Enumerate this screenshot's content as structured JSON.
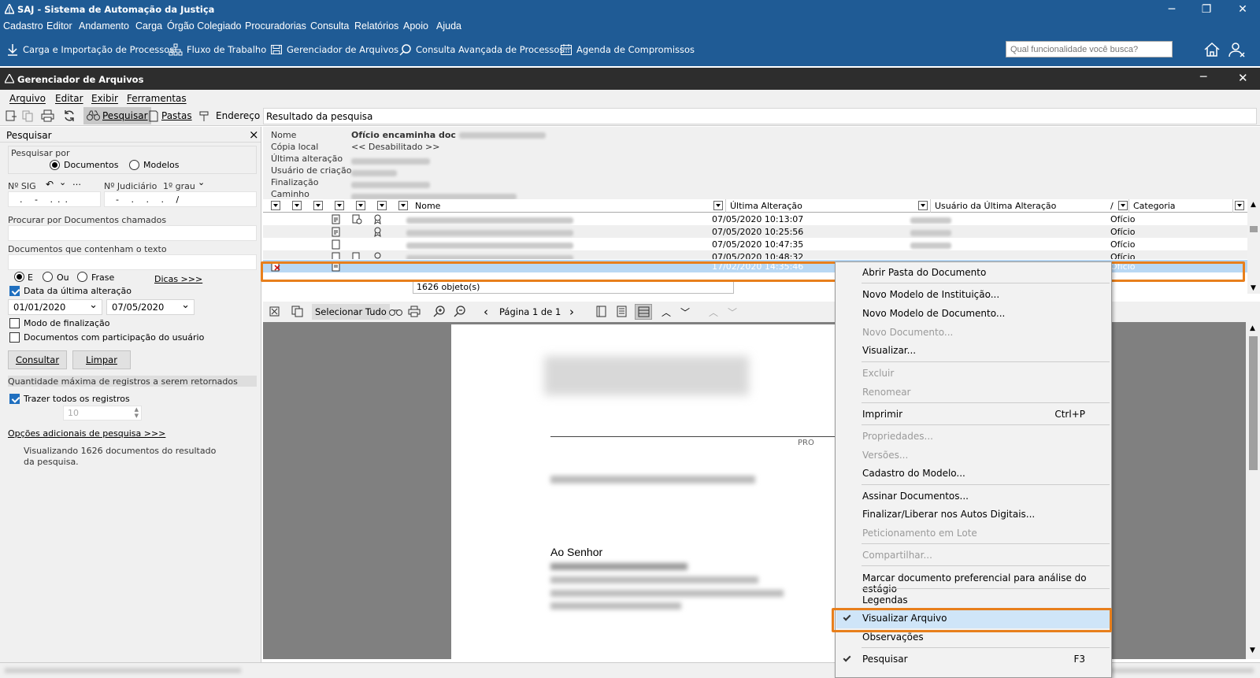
{
  "app": {
    "title": "SAJ - Sistema de Automação da Justiça",
    "menu": [
      "Cadastro",
      "Editor",
      "Andamento",
      "Carga",
      "Órgão Colegiado",
      "Procuradorias",
      "Consulta",
      "Relatórios",
      "Apoio",
      "Ajuda"
    ],
    "quick_actions": [
      "Carga e Importação de Processos",
      "Fluxo de Trabalho",
      "Gerenciador de Arquivos",
      "Consulta Avançada de Processos",
      "Agenda de Compromissos"
    ],
    "search_placeholder": "Qual funcionalidade você busca?"
  },
  "file_manager": {
    "title": "Gerenciador de Arquivos",
    "menu": [
      "Arquivo",
      "Editar",
      "Exibir",
      "Ferramentas"
    ],
    "toolbar": {
      "pesquisar": "Pesquisar",
      "pastas": "Pastas",
      "endereco": "Endereço"
    },
    "address_value": "Resultado da pesquisa"
  },
  "search_panel": {
    "title": "Pesquisar",
    "close": "×",
    "search_by_label": "Pesquisar por",
    "opt_documentos": "Documentos",
    "opt_modelos": "Modelos",
    "sig_label": "Nº SIG",
    "sig_value": ". - ...",
    "judicial_label": "Nº Judiciário",
    "grau": "1º grau",
    "judicial_value": "- . . . /",
    "docs_called_label": "Procurar por Documentos chamados",
    "docs_text_label": "Documentos que contenham o texto",
    "opt_e": "E",
    "opt_ou": "Ou",
    "opt_frase": "Frase",
    "dicas": "Dicas >>>",
    "last_change_label": "Data da última alteração",
    "date_from": "01/01/2020",
    "date_to": "07/05/2020",
    "finalization_label": "Modo de finalização",
    "participation_label": "Documentos com participação do usuário",
    "consultar": "Consultar",
    "limpar": "Limpar",
    "max_records_label": "Quantidade máxima de registros a serem retornados",
    "all_records_label": "Trazer todos os registros",
    "max_value": "10",
    "more_options": "Opções adicionais de pesquisa >>>",
    "result_info": "Visualizando 1626 documentos do resultado da pesquisa."
  },
  "properties": {
    "labels": [
      "Nome",
      "Cópia local",
      "Última alteração",
      "Usuário de criação",
      "Finalização",
      "Caminho"
    ],
    "nome_value": "Ofício encaminha doc",
    "copia_value": "<< Desabilitado >>"
  },
  "grid": {
    "headers": {
      "nome": "Nome",
      "ultima": "Última Alteração",
      "usuario": "Usuário da Última Alteração",
      "sort": "/",
      "categoria": "Categoria"
    },
    "rows": [
      {
        "date": "07/05/2020 10:13:07",
        "cat": "Ofício"
      },
      {
        "date": "07/05/2020 10:25:56",
        "cat": "Ofício"
      },
      {
        "date": "07/05/2020 10:47:35",
        "cat": "Ofício"
      },
      {
        "date": "07/05/2020 10:48:32",
        "cat": "Ofício"
      },
      {
        "date": "17/02/2020 14:35:46",
        "cat": "Ofício"
      }
    ],
    "status": "1626 objeto(s)"
  },
  "viewer": {
    "select_all": "Selecionar Tudo",
    "page": "Página 1 de 1",
    "doc_greeting": "Ao Senhor",
    "doc_pro": "PRO"
  },
  "context_menu": {
    "items": [
      {
        "label": "Abrir Pasta do Documento",
        "disabled": false
      },
      {
        "label": "Novo Modelo de Instituição...",
        "disabled": false
      },
      {
        "label": "Novo Modelo de Documento...",
        "disabled": false
      },
      {
        "label": "Novo Documento...",
        "disabled": true
      },
      {
        "label": "Visualizar...",
        "disabled": false
      },
      {
        "label": "Excluir",
        "disabled": true
      },
      {
        "label": "Renomear",
        "disabled": true
      },
      {
        "label": "Imprimir",
        "shortcut": "Ctrl+P",
        "disabled": false
      },
      {
        "label": "Propriedades...",
        "disabled": true
      },
      {
        "label": "Versões...",
        "disabled": true
      },
      {
        "label": "Cadastro do Modelo...",
        "disabled": false
      },
      {
        "label": "Assinar Documentos...",
        "disabled": false
      },
      {
        "label": "Finalizar/Liberar nos Autos Digitais...",
        "disabled": false
      },
      {
        "label": "Peticionamento em Lote",
        "disabled": true
      },
      {
        "label": "Compartilhar...",
        "disabled": true
      },
      {
        "label": "Marcar documento preferencial para análise do estágio",
        "disabled": false
      },
      {
        "label": "Legendas",
        "disabled": false
      },
      {
        "label": "Visualizar Arquivo",
        "checked": true,
        "disabled": false
      },
      {
        "label": "Observações",
        "disabled": false
      },
      {
        "label": "Pesquisar",
        "checked": true,
        "shortcut": "F3",
        "disabled": false
      }
    ]
  },
  "colors": {
    "brand_blue": "#1f5b95",
    "highlight_orange": "#e87f1c",
    "selection": "#b9d8f4"
  }
}
